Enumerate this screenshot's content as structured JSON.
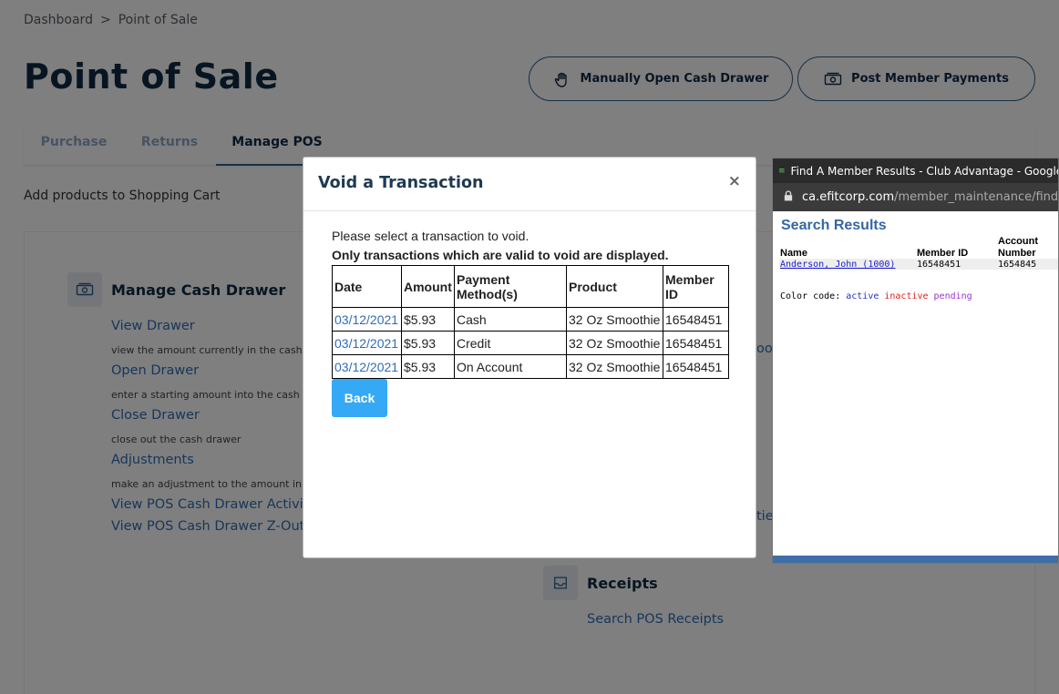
{
  "breadcrumb": {
    "items": [
      "Dashboard",
      "Point of Sale"
    ],
    "separator": ">"
  },
  "page": {
    "title": "Point of Sale",
    "subtitle": "Add products to Shopping Cart"
  },
  "header_buttons": {
    "open_drawer": "Manually Open Cash Drawer",
    "post_payments": "Post Member Payments"
  },
  "tabs": [
    {
      "label": "Purchase",
      "active": false
    },
    {
      "label": "Returns",
      "active": false
    },
    {
      "label": "Manage POS",
      "active": true
    }
  ],
  "cash_drawer": {
    "title": "Manage Cash Drawer",
    "items": [
      {
        "label": "View Drawer",
        "desc": "view the amount currently in the cash"
      },
      {
        "label": "Open Drawer",
        "desc": "enter a starting amount into the cash"
      },
      {
        "label": "Close Drawer",
        "desc": "close out the cash drawer"
      },
      {
        "label": "Adjustments",
        "desc": "make an adjustment to the amount in"
      },
      {
        "label": "View POS Cash Drawer Activit",
        "desc": ""
      },
      {
        "label": "View POS Cash Drawer Z-Out",
        "desc": ""
      }
    ]
  },
  "partial_links": {
    "p1": "oo",
    "p2": "tie"
  },
  "receipts": {
    "title": "Receipts",
    "link": "Search POS Receipts"
  },
  "modal": {
    "title": "Void a Transaction",
    "close": "×",
    "line1": "Please select a transaction to void.",
    "line2": "Only transactions which are valid to void are displayed.",
    "columns": [
      "Date",
      "Amount",
      "Payment Method(s)",
      "Product",
      "Member ID"
    ],
    "rows": [
      {
        "date": "03/12/2021",
        "amount": "$5.93",
        "method": "Cash",
        "product": "32 Oz Smoothie",
        "member_id": "16548451"
      },
      {
        "date": "03/12/2021",
        "amount": "$5.93",
        "method": "Credit",
        "product": "32 Oz Smoothie",
        "member_id": "16548451"
      },
      {
        "date": "03/12/2021",
        "amount": "$5.93",
        "method": "On Account",
        "product": "32 Oz Smoothie",
        "member_id": "16548451"
      }
    ],
    "back_label": "Back"
  },
  "popup": {
    "window_title": "Find A Member Results - Club Advantage - Google Ch...",
    "url_host": "ca.efitcorp.com",
    "url_path": "/member_maintenance/find_m",
    "heading": "Search Results",
    "columns": {
      "name": "Name",
      "member_id": "Member ID",
      "account_1": "Account",
      "account_2": "Number"
    },
    "row": {
      "name": "Anderson, John (1000)",
      "member_id": "16548451",
      "account": "1654845"
    },
    "color_code": {
      "label": "Color code:",
      "active": "active",
      "inactive": "inactive",
      "pending": "pending"
    }
  },
  "colors": {
    "accent": "#2f6db5",
    "title": "#0f2a44",
    "back_button": "#35a9f5",
    "popup_heading": "#3467a6"
  }
}
